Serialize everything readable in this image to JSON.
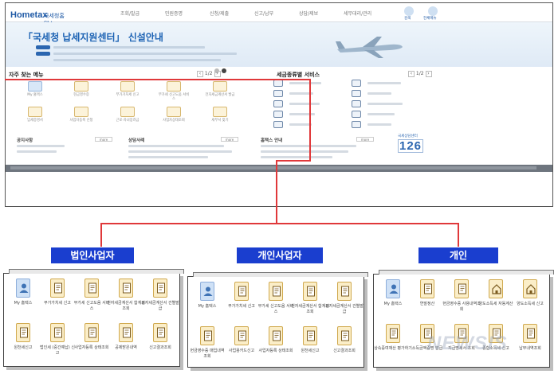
{
  "site": {
    "logo_main": "Hometax",
    "logo_sub": "국세청홈택스",
    "menu": [
      "조회/발급",
      "민원증명",
      "신청/제출",
      "신고/납부",
      "상담/제보",
      "세무대리/관리"
    ],
    "right_links": [
      "검색",
      "전체메뉴"
    ],
    "banner_title": "「국세청 납세지원센터」 신설안내",
    "frequent_menu_title": "자주 찾는 메뉴",
    "frequent_pager": "1/2",
    "tax_service_title": "세금종류별 서비스",
    "tax_pager": "1/2",
    "frequent_items": [
      "My 홈택스",
      "현금영수증",
      "부가가치세 신고",
      "부가세 신고도움 서비스",
      "전자세금계산서 발급",
      "납세증명서",
      "사업자등록 신청",
      "근로·자녀장려금",
      "사업자상태조회",
      "세무서 찾기"
    ],
    "notice_title": "공지사항",
    "consult_title": "상담사례",
    "news_title": "홈택스 안내",
    "more": "more",
    "tel_caption": "국세상담센터",
    "tel_number": "126"
  },
  "categories": {
    "corporate": "법인사업자",
    "individual_business": "개인사업자",
    "individual": "개인"
  },
  "panel_corporate": [
    {
      "label": "My 홈택스",
      "icon": "person-icon"
    },
    {
      "label": "부가가치세 신고",
      "icon": "document-icon"
    },
    {
      "label": "부가세 신고도움 서비스",
      "icon": "document-icon"
    },
    {
      "label": "전자세금계산서 합계표조회",
      "icon": "document-icon"
    },
    {
      "label": "전자세금계산서 건별발급",
      "icon": "document-icon"
    },
    {
      "label": "원천세신고",
      "icon": "document-icon"
    },
    {
      "label": "법인세 (중간예납) 신고",
      "icon": "document-icon"
    },
    {
      "label": "사업자등록 상태조회",
      "icon": "document-icon"
    },
    {
      "label": "공제받은내역",
      "icon": "document-icon"
    },
    {
      "label": "신고결과조회",
      "icon": "document-icon"
    }
  ],
  "panel_individual_business": [
    {
      "label": "My 홈택스",
      "icon": "person-icon"
    },
    {
      "label": "부가가치세 신고",
      "icon": "document-icon"
    },
    {
      "label": "부가세 신고도움 서비스",
      "icon": "document-icon"
    },
    {
      "label": "전자세금계산서 합계표조회",
      "icon": "document-icon"
    },
    {
      "label": "전자세금계산서 건별발급",
      "icon": "document-icon"
    },
    {
      "label": "현금영수증 매입내역 조회",
      "icon": "document-icon"
    },
    {
      "label": "사업용카드신고",
      "icon": "document-icon"
    },
    {
      "label": "사업자등록 상태조회",
      "icon": "document-icon"
    },
    {
      "label": "원천세신고",
      "icon": "document-icon"
    },
    {
      "label": "신고결과조회",
      "icon": "document-icon"
    }
  ],
  "panel_individual": [
    {
      "label": "My 홈택스",
      "icon": "person-icon"
    },
    {
      "label": "연말정산",
      "icon": "document-icon"
    },
    {
      "label": "현금영수증 사용내역조회",
      "icon": "document-icon"
    },
    {
      "label": "양도소득세 자동계산",
      "icon": "house-icon"
    },
    {
      "label": "양도소득세 신고",
      "icon": "house-icon"
    },
    {
      "label": "상속증여재산 평가하기",
      "icon": "document-icon"
    },
    {
      "label": "소득금액증명 발급",
      "icon": "document-icon"
    },
    {
      "label": "지급명세서 조회",
      "icon": "document-icon"
    },
    {
      "label": "종합소득세 신고",
      "icon": "document-icon"
    },
    {
      "label": "납부내역조회",
      "icon": "document-icon"
    }
  ],
  "watermark": "NEWSIS"
}
